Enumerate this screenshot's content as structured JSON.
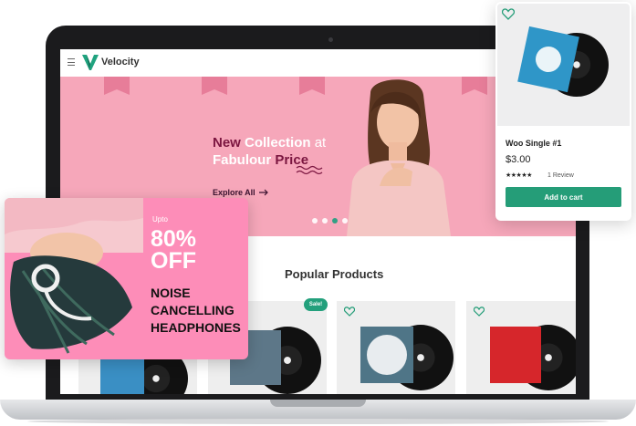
{
  "site": {
    "brand": "Velocity"
  },
  "hero": {
    "title_1a": "New",
    "title_1b": "Collection",
    "title_1c": "at",
    "title_2a": "Fabulour",
    "title_2b": "Price",
    "explore": "Explore All",
    "slides": 4,
    "active_slide": 3
  },
  "main": {
    "popular_title": "Popular Products",
    "sale_badge": "Sale!"
  },
  "product_card": {
    "name": "Woo Single #1",
    "price": "$3.00",
    "stars": "★★★★★",
    "rating": 5,
    "reviews": "1 Review",
    "button": "Add to cart"
  },
  "promo": {
    "upto": "Upto",
    "percent": "80%",
    "off": "OFF",
    "line1": "NOISE",
    "line2": "CANCELLING",
    "line3": "HEADPHONES"
  },
  "colors": {
    "accent": "#259d78",
    "hero_bg": "#f6a7ba",
    "promo_bg": "#fd8db8",
    "hero_text": "#3b1330"
  },
  "icons": [
    "menu-icon",
    "logo-icon",
    "heart-icon",
    "arrow-right-icon"
  ]
}
